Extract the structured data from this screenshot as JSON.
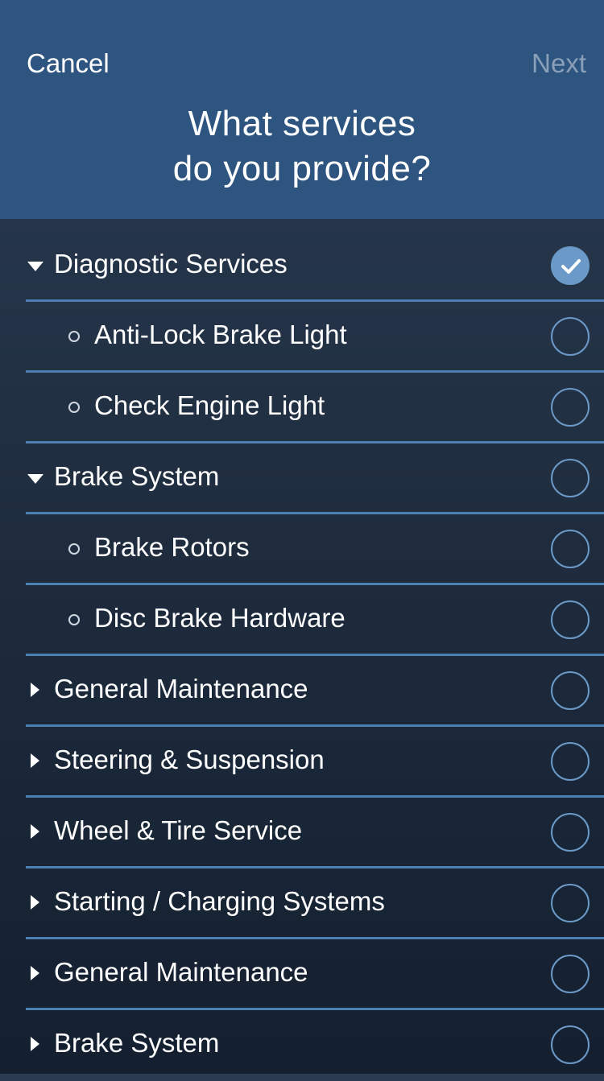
{
  "header": {
    "cancel_label": "Cancel",
    "next_label": "Next",
    "title_line1": "What services",
    "title_line2": "do you provide?"
  },
  "colors": {
    "header_bg": "#2e5580",
    "accent": "#6b99c8",
    "divider": "#4d7fb2",
    "next_disabled": "#8a9fb8"
  },
  "services": [
    {
      "label": "Diagnostic Services",
      "level": "parent",
      "expanded": true,
      "selected": true
    },
    {
      "label": "Anti-Lock Brake Light",
      "level": "child",
      "selected": false
    },
    {
      "label": "Check Engine Light",
      "level": "child",
      "selected": false
    },
    {
      "label": "Brake System",
      "level": "parent",
      "expanded": true,
      "selected": false
    },
    {
      "label": "Brake Rotors",
      "level": "child",
      "selected": false
    },
    {
      "label": "Disc Brake Hardware",
      "level": "child",
      "selected": false
    },
    {
      "label": "General Maintenance",
      "level": "parent",
      "expanded": false,
      "selected": false
    },
    {
      "label": "Steering & Suspension",
      "level": "parent",
      "expanded": false,
      "selected": false
    },
    {
      "label": "Wheel & Tire Service",
      "level": "parent",
      "expanded": false,
      "selected": false
    },
    {
      "label": "Starting / Charging Systems",
      "level": "parent",
      "expanded": false,
      "selected": false
    },
    {
      "label": "General Maintenance",
      "level": "parent",
      "expanded": false,
      "selected": false
    },
    {
      "label": "Brake System",
      "level": "parent",
      "expanded": false,
      "selected": false
    }
  ]
}
